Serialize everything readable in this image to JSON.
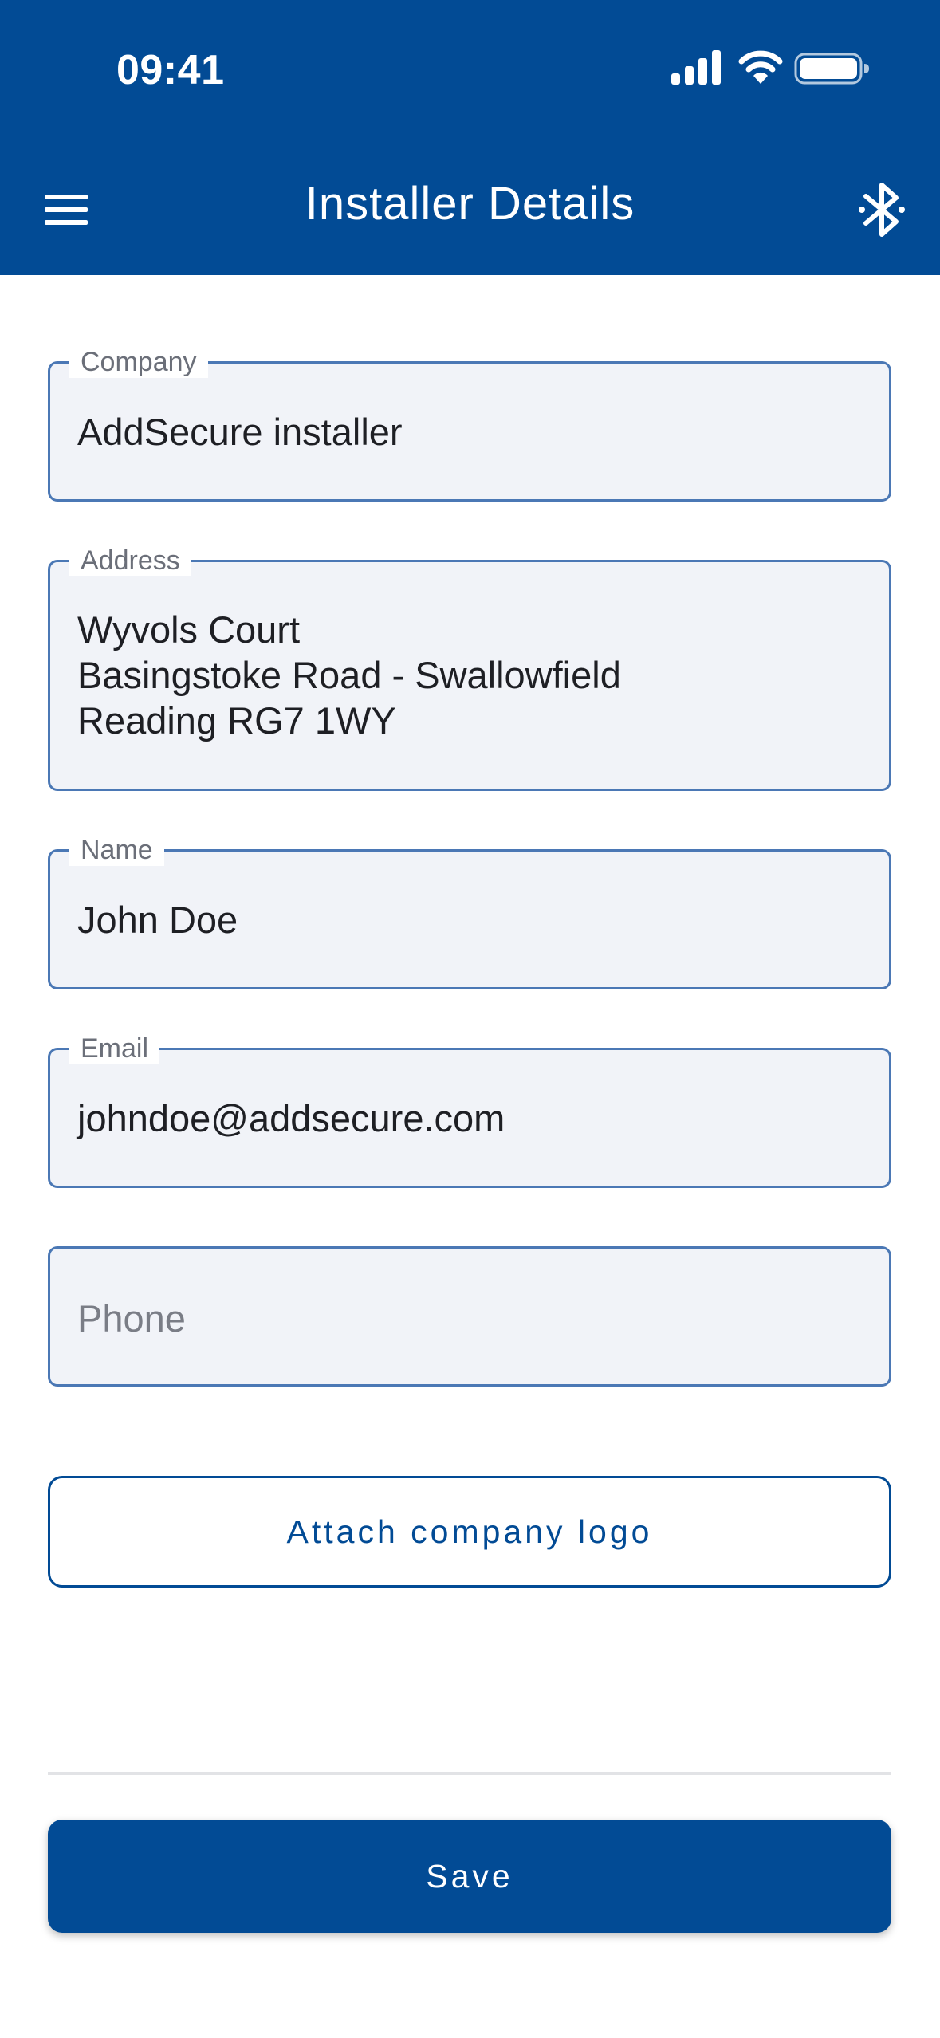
{
  "status_bar": {
    "time": "09:41"
  },
  "app_bar": {
    "title": "Installer Details",
    "menu_icon": "hamburger-menu-icon",
    "bluetooth_icon": "bluetooth-icon"
  },
  "form": {
    "company": {
      "label": "Company",
      "value": "AddSecure installer"
    },
    "address": {
      "label": "Address",
      "value": "Wyvols Court\nBasingstoke Road - Swallowfield\nReading RG7 1WY"
    },
    "name": {
      "label": "Name",
      "value": "John Doe"
    },
    "email": {
      "label": "Email",
      "value": "johndoe@addsecure.com"
    },
    "phone": {
      "placeholder": "Phone"
    }
  },
  "actions": {
    "attach_logo": "Attach company logo",
    "save": "Save"
  },
  "colors": {
    "primary": "#024b95",
    "field_border": "#4b78b5",
    "field_background": "#f1f3f8"
  }
}
